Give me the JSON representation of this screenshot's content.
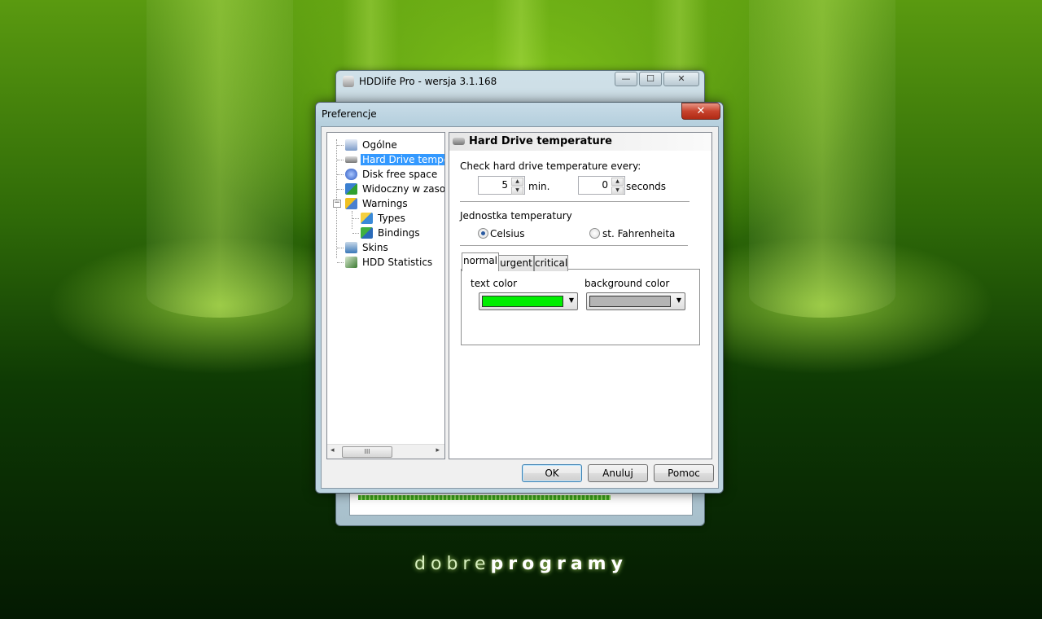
{
  "brand": {
    "light": "dobre",
    "bold": "programy"
  },
  "background_window": {
    "title": "HDDlife Pro - wersja 3.1.168",
    "controls": {
      "minimize": "—",
      "maximize": "☐",
      "close": "✕"
    }
  },
  "dialog": {
    "title": "Preferencje",
    "close": "✕",
    "tree": {
      "items": [
        {
          "label": "Ogólne",
          "icon": "settings-icon"
        },
        {
          "label": "Hard Drive temper",
          "icon": "hard-drive-icon",
          "selected": true
        },
        {
          "label": "Disk free space",
          "icon": "disk-space-icon"
        },
        {
          "label": "Widoczny w zasob",
          "icon": "tray-icon"
        },
        {
          "label": "Warnings",
          "icon": "warnings-icon",
          "expanded": true,
          "expander": "−"
        },
        {
          "label": "Types",
          "icon": "types-icon"
        },
        {
          "label": "Bindings",
          "icon": "bindings-icon"
        },
        {
          "label": "Skins",
          "icon": "skins-icon"
        },
        {
          "label": "HDD Statistics",
          "icon": "statistics-icon"
        }
      ],
      "scroll": {
        "left": "◂",
        "right": "▸",
        "thumb": "III"
      }
    },
    "panel": {
      "header": "Hard Drive temperature",
      "check_label": "Check hard drive temperature every:",
      "minutes": {
        "value": "5",
        "unit": "min."
      },
      "seconds": {
        "value": "0",
        "unit": "seconds"
      },
      "spin": {
        "up": "▲",
        "down": "▼"
      },
      "unit_label": "Jednostka temperatury",
      "celsius": "Celsius",
      "fahrenheit": "st. Fahrenheita",
      "selected_unit": "Celsius",
      "tabs": [
        "normal",
        "urgent",
        "critical"
      ],
      "active_tab": "normal",
      "text_color_label": "text color",
      "background_color_label": "background color",
      "text_color": "#00ee00",
      "background_color": "#b4b4b4",
      "dropdown_arrow": "▼"
    },
    "buttons": {
      "ok": "OK",
      "cancel": "Anuluj",
      "help": "Pomoc"
    }
  }
}
